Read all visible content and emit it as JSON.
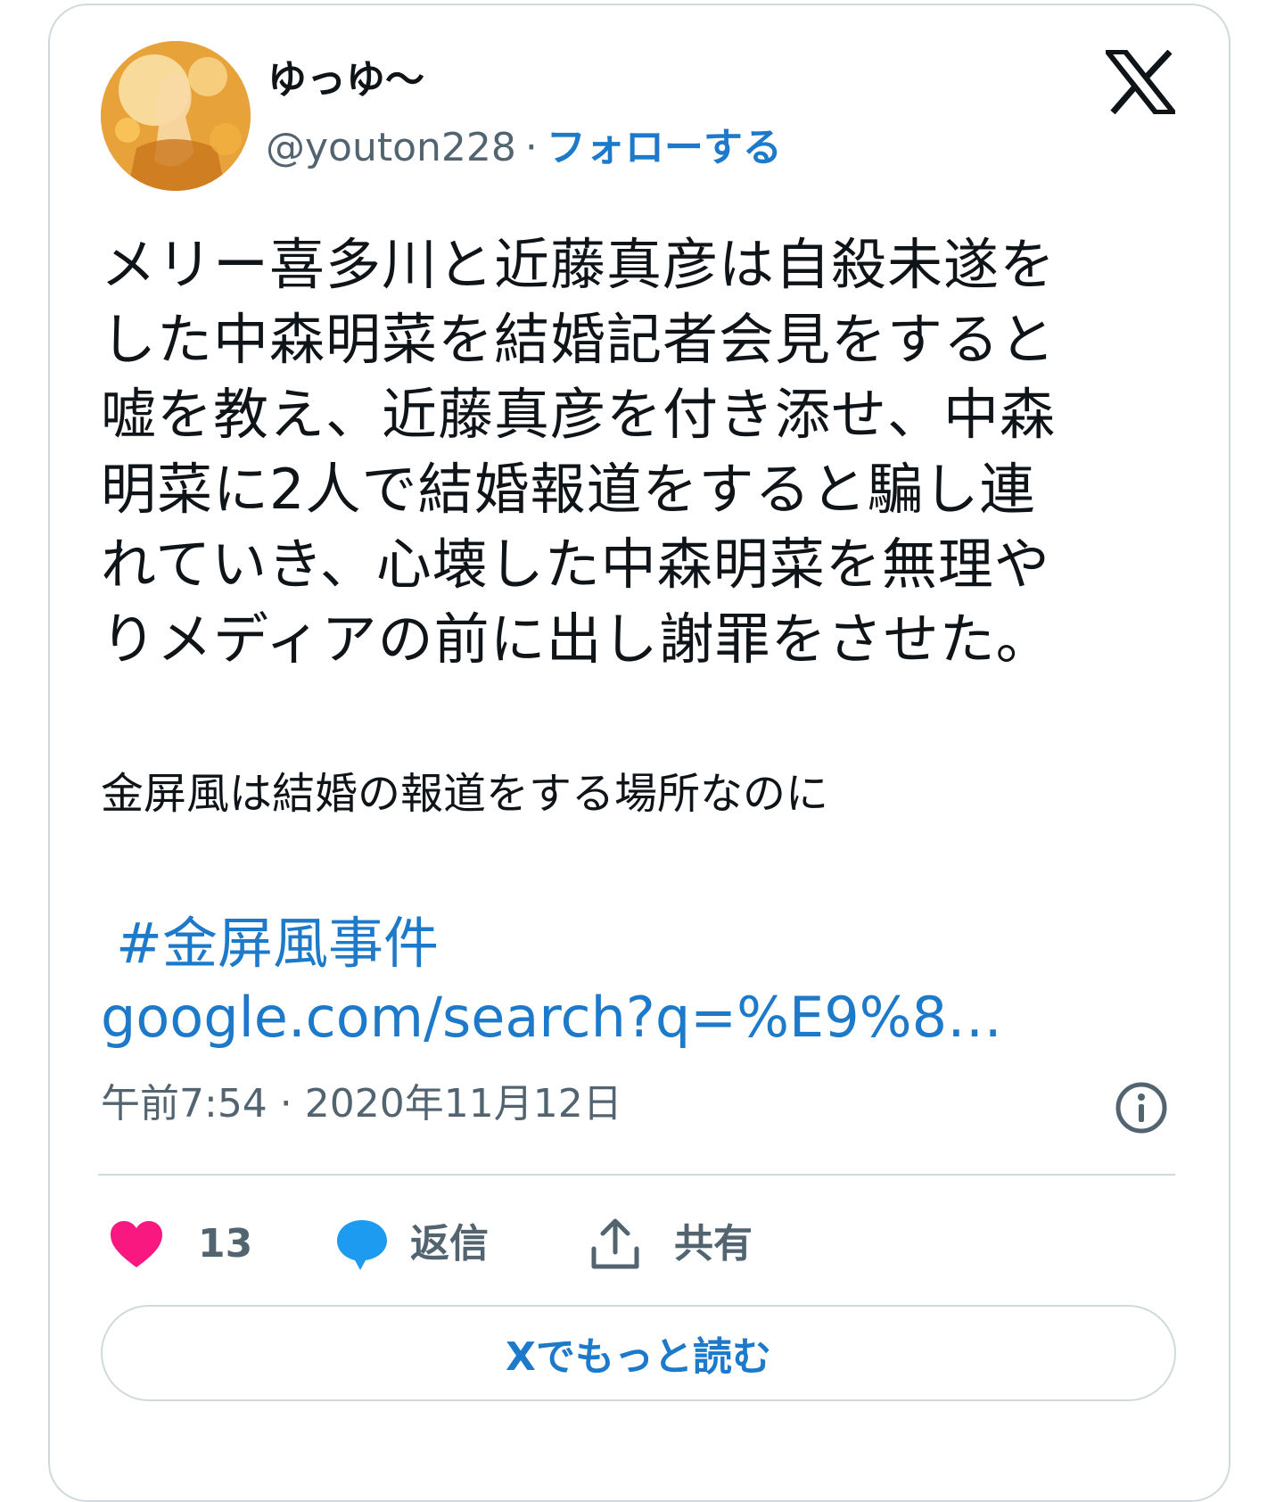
{
  "user": {
    "display_name": "ゆっゆ〜",
    "handle": "@youton228",
    "separator": "·",
    "follow_label": "フォローする"
  },
  "tweet": {
    "lines": [
      "メリー喜多川と近藤真彦は自殺未遂を",
      "した中森明菜を結婚記者会見をすると",
      "嘘を教え、近藤真彦を付き添せ、中森",
      "明菜に2人で結婚報道をすると騙し連",
      "れていき、心壊した中森明菜を無理や",
      "りメディアの前に出し謝罪をさせた。"
    ],
    "secondary": "金屏風は結婚の報道をする場所なのに",
    "hashtag": "#金屏風事件",
    "link": "google.com/search?q=%E9%8…",
    "timestamp": "午前7:54 · 2020年11月12日"
  },
  "actions": {
    "like_count": "13",
    "reply_label": "返信",
    "share_label": "共有"
  },
  "read_more_label": "Xでもっと読む",
  "icons": {
    "logo": "x-logo-icon",
    "info": "info-icon",
    "like": "heart-icon",
    "reply": "speech-bubble-icon",
    "share": "share-upload-icon"
  },
  "colors": {
    "link": "#1d79c9",
    "heart": "#f91880",
    "reply_bubble": "#1d9bf0",
    "muted": "#536471",
    "border": "#cfd9de"
  }
}
